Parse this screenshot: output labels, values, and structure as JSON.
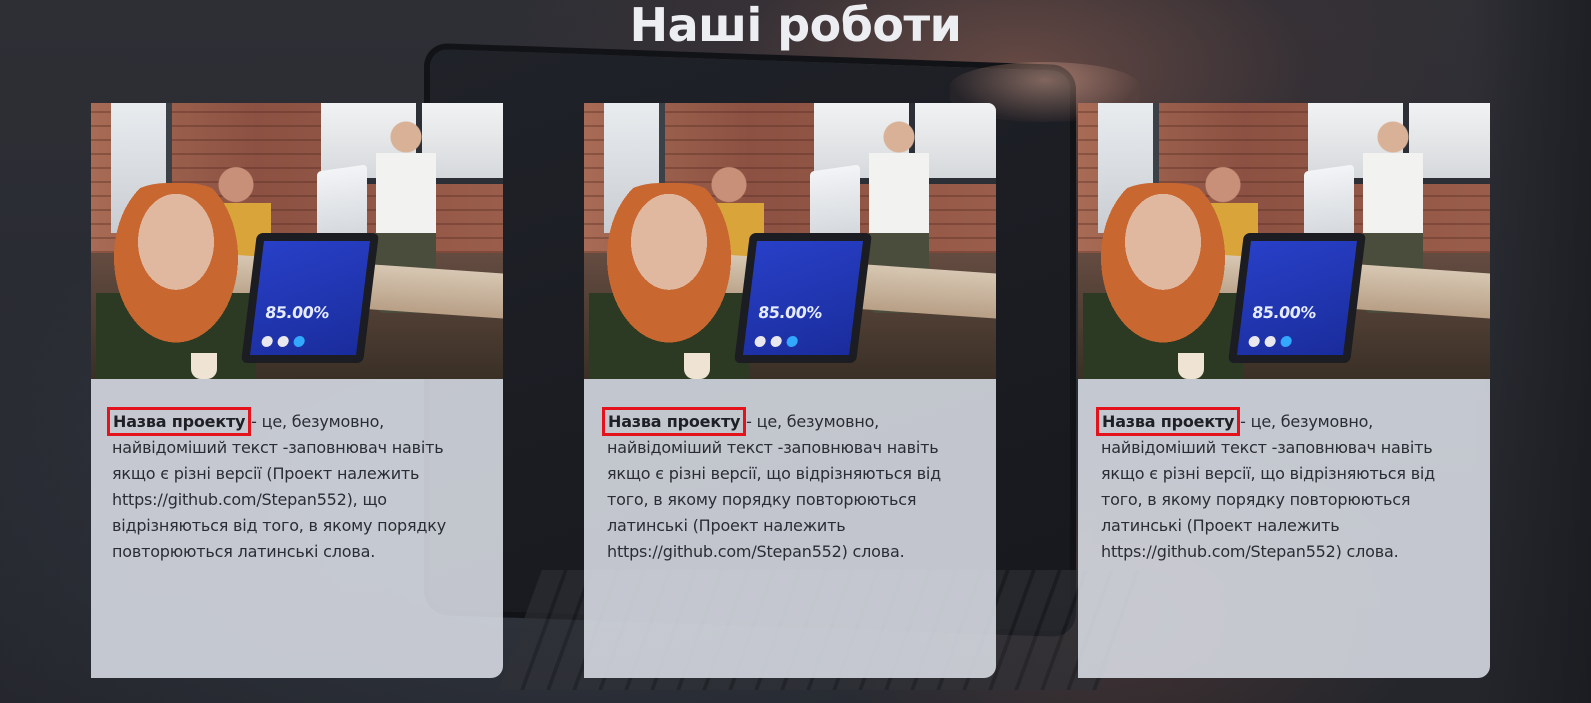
{
  "section": {
    "title": "Наші роботи"
  },
  "cards": [
    {
      "project_name": "Назва проекту",
      "description": " - це, безумовно, найвідоміший текст -заповнювач навіть якщо є різні версії (Проект належить https://github.com/Stepan552), що відрізняються від того, в якому порядку повторюються латинські слова.",
      "image": {
        "laptop_value": "85.00%",
        "alt": "photo-office-team"
      }
    },
    {
      "project_name": "Назва проекту",
      "description": " - це, безумовно, найвідоміший текст -заповнювач навіть якщо є різні версії, що відрізняються від того, в якому порядку повторюються латинські (Проект належить https://github.com/Stepan552) слова.",
      "image": {
        "laptop_value": "85.00%",
        "alt": "photo-office-team"
      }
    },
    {
      "project_name": "Назва проекту",
      "description": " - це, безумовно, найвідоміший текст -заповнювач навіть якщо є різні версії, що відрізняються від того, в якому порядку повторюються латинські (Проект належить https://github.com/Stepan552) слова.",
      "image": {
        "laptop_value": "85.00%",
        "alt": "photo-office-team"
      }
    }
  ],
  "colors": {
    "highlight_border": "#e4131b",
    "card_background": "#dee2ea",
    "title_color": "#eceef2",
    "laptop_accent": "#33a8ff"
  }
}
